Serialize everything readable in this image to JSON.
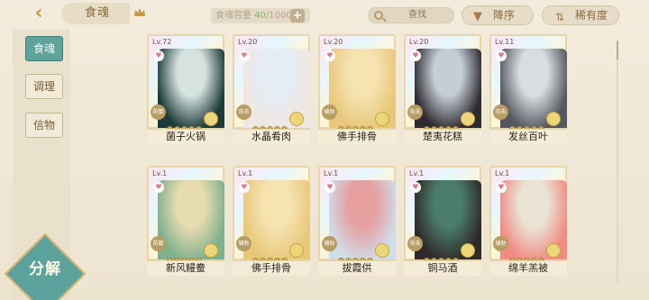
{
  "header": {
    "back_icon": "back-arrow-icon",
    "title": "食魂",
    "capacity_label": "食魂容量",
    "capacity_current": "40",
    "capacity_total": "/1000",
    "search_label": "查找",
    "sort_order_label": "降序",
    "sort_rarity_label": "稀有度"
  },
  "sidebar": {
    "tabs": [
      {
        "label": "食魂",
        "active": true
      },
      {
        "label": "调理",
        "active": false
      },
      {
        "label": "信物",
        "active": false
      }
    ],
    "decompose_label": "分解"
  },
  "cards": [
    {
      "level": "Lv.72",
      "name": "菌子火锅",
      "role": "防御",
      "colors": [
        "#1c3b3a",
        "#d6e2e0"
      ]
    },
    {
      "level": "Lv.20",
      "name": "水晶肴肉",
      "role": "攻击",
      "colors": [
        "#f0e7e2",
        "#e4ecf4"
      ]
    },
    {
      "level": "Lv.20",
      "name": "佛手排骨",
      "role": "辅助",
      "colors": [
        "#e8c77a",
        "#f6e3b0"
      ]
    },
    {
      "level": "Lv.20",
      "name": "楚夷花糕",
      "role": "攻击",
      "colors": [
        "#2e2a30",
        "#c5cdd6"
      ]
    },
    {
      "level": "Lv.11",
      "name": "发丝百叶",
      "role": "攻击",
      "colors": [
        "#54585e",
        "#d8dde2"
      ]
    },
    {
      "level": "Lv.1",
      "name": "新风鳗鲞",
      "role": "防御",
      "colors": [
        "#7fb08d",
        "#e6dcb0"
      ]
    },
    {
      "level": "Lv.1",
      "name": "佛手排骨",
      "role": "辅助",
      "colors": [
        "#e8c77a",
        "#f6e3b0"
      ]
    },
    {
      "level": "Lv.1",
      "name": "拔霞供",
      "role": "辅助",
      "colors": [
        "#d0dce8",
        "#e6a0a0"
      ]
    },
    {
      "level": "Lv.1",
      "name": "铜马酒",
      "role": "攻击",
      "colors": [
        "#2f2a2a",
        "#4b7d6a"
      ]
    },
    {
      "level": "Lv.1",
      "name": "绵羊羔被",
      "role": "辅助",
      "colors": [
        "#f08c84",
        "#eae4d4"
      ]
    }
  ]
}
